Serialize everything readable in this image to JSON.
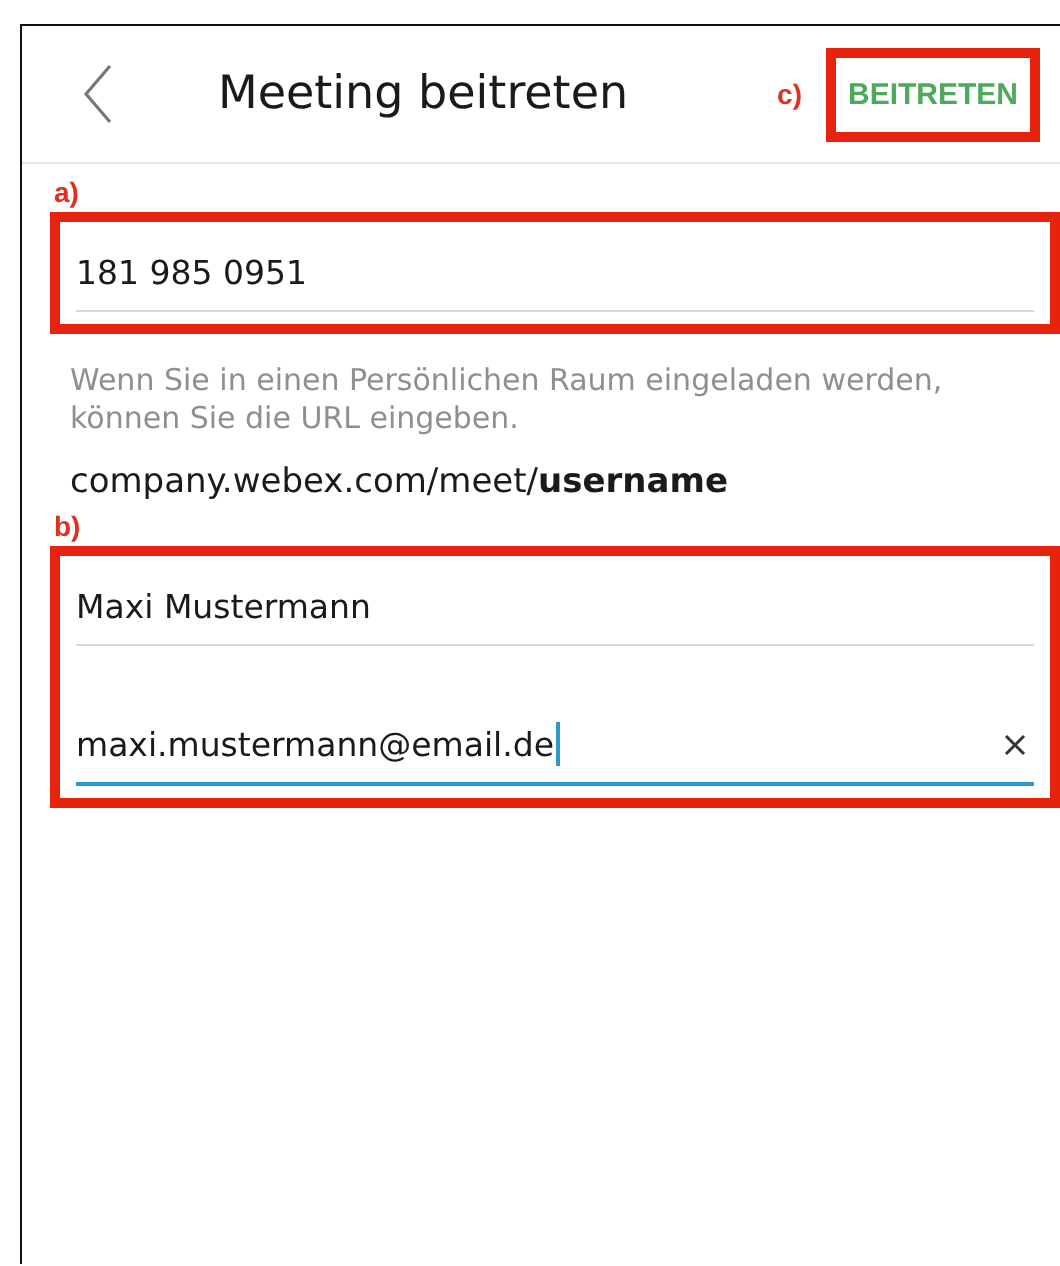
{
  "header": {
    "title": "Meeting beitreten",
    "action": {
      "label": "BEITRETEN",
      "marker": "c)"
    }
  },
  "meeting_section": {
    "marker": "a)",
    "field": {
      "value": "181 985 0951",
      "focused": false
    }
  },
  "hint": "Wenn Sie in einen Persönlichen Raum eingeladen werden, können Sie die URL eingeben.",
  "url_example": "company.webex.com/meet/**username**",
  "identity_section": {
    "marker": "b)",
    "fields": [
      {
        "value": "Maxi Mustermann",
        "focused": false,
        "clear_button": false
      },
      {
        "value": "maxi.mustermann@email.de",
        "focused": true,
        "clear_button": true
      }
    ]
  }
}
